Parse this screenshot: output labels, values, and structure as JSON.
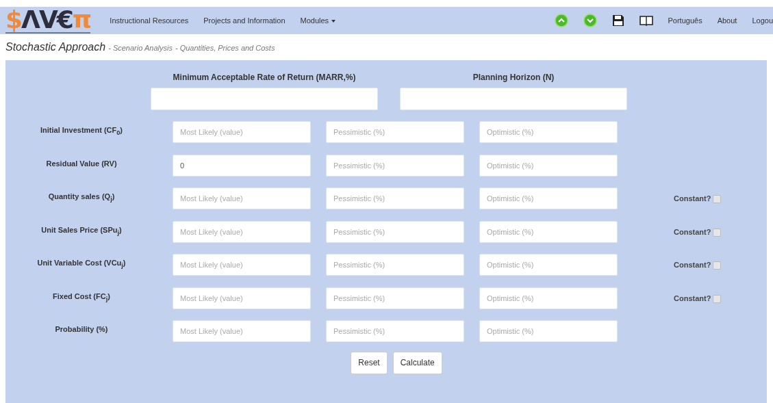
{
  "navbar": {
    "logo": [
      {
        "text": "$",
        "accent": true
      },
      {
        "text": "ΛV€",
        "accent": false
      },
      {
        "text": "π",
        "accent": true
      }
    ],
    "links": [
      {
        "label": "Instructional Resources",
        "dropdown": false
      },
      {
        "label": "Projects and Information",
        "dropdown": false
      },
      {
        "label": "Modules",
        "dropdown": true
      }
    ],
    "icons": [
      {
        "kind": "up"
      },
      {
        "kind": "down"
      },
      {
        "kind": "save"
      },
      {
        "kind": "book"
      }
    ],
    "right_links": [
      "Português",
      "About",
      "Logou"
    ]
  },
  "breadcrumb": {
    "title": "Stochastic Approach",
    "parts": [
      "- Scenario Analysis",
      "- Quantities, Prices and Costs"
    ]
  },
  "top_fields": [
    {
      "label": "Minimum Acceptable Rate of Return (MARR,%)"
    },
    {
      "label": "Planning Horizon (N)"
    }
  ],
  "rows": [
    {
      "label": "Initial Investment (CF$_{0}$)",
      "fields": [
        {
          "placeholder": "Most Likely (value)"
        },
        {
          "placeholder": "Pessimistic (%)"
        },
        {
          "placeholder": "Optimistic (%)"
        }
      ]
    },
    {
      "label": "Residual Value (RV)",
      "fields": [
        {
          "value": "0"
        },
        {
          "placeholder": "Pessimistic (%)"
        },
        {
          "placeholder": "Optimistic (%)"
        }
      ]
    },
    {
      "label": "Quantity sales (Q$_{j}$)",
      "fields": [
        {
          "placeholder": "Most Likely (value)"
        },
        {
          "placeholder": "Pessimistic (%)"
        },
        {
          "placeholder": "Optimistic (%)"
        }
      ],
      "constant": {
        "label": "Constant?",
        "checked": false
      }
    },
    {
      "label": "Unit Sales Price (SPu$_{j}$)",
      "fields": [
        {
          "placeholder": "Most Likely (value)"
        },
        {
          "placeholder": "Pessimistic (%)"
        },
        {
          "placeholder": "Optimistic (%)"
        }
      ],
      "constant": {
        "label": "Constant?",
        "checked": false
      }
    },
    {
      "label": "Unit Variable Cost (VCu$_{j}$)",
      "fields": [
        {
          "placeholder": "Most Likely (value)"
        },
        {
          "placeholder": "Pessimistic (%)"
        },
        {
          "placeholder": "Optimistic (%)"
        }
      ],
      "constant": {
        "label": "Constant?",
        "checked": false
      }
    },
    {
      "label": "Fixed Cost (FC$_{j}$)",
      "fields": [
        {
          "placeholder": "Most Likely (value)"
        },
        {
          "placeholder": "Pessimistic (%)"
        },
        {
          "placeholder": "Optimistic (%)"
        }
      ],
      "constant": {
        "label": "Constant?",
        "checked": false
      }
    },
    {
      "label": "Probability (%)",
      "fields": [
        {
          "placeholder": "Most Likely (value)"
        },
        {
          "placeholder": "Pessimistic (%)"
        },
        {
          "placeholder": "Optimistic (%)"
        }
      ]
    }
  ],
  "buttons": [
    "Reset",
    "Calculate"
  ]
}
